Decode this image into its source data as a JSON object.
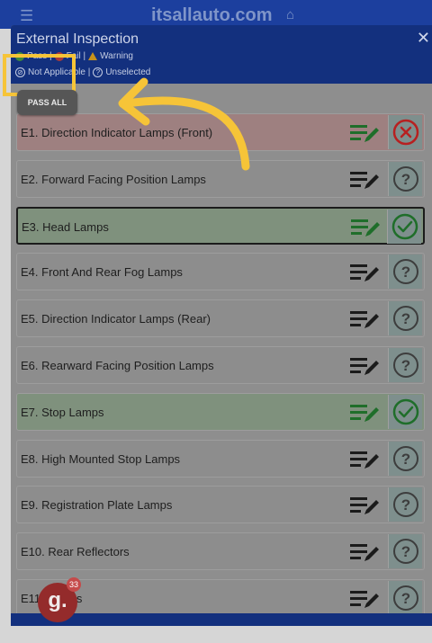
{
  "topbar": {
    "menu_icon": "menu-icon",
    "site_title": "itsallauto.com",
    "home_icon": "home-icon"
  },
  "modal": {
    "title": "External Inspection",
    "close_icon": "close-icon",
    "legend_line1": {
      "pass": "Pass |",
      "fail": "Fail |",
      "warning": "Warning"
    },
    "legend_line2": {
      "not_applicable": "Not Applicable |",
      "unselected": "Unselected"
    },
    "pass_all_label": "PASS ALL"
  },
  "rows": [
    {
      "label": "E1. Direction Indicator Lamps (Front)",
      "status": "fail"
    },
    {
      "label": "E2. Forward Facing Position Lamps",
      "status": "unselected"
    },
    {
      "label": "E3. Head Lamps",
      "status": "pass"
    },
    {
      "label": "E4. Front And Rear Fog Lamps",
      "status": "unselected"
    },
    {
      "label": "E5. Direction Indicator Lamps (Rear)",
      "status": "unselected"
    },
    {
      "label": "E6. Rearward Facing Position Lamps",
      "status": "unselected"
    },
    {
      "label": "E7. Stop Lamps",
      "status": "pass"
    },
    {
      "label": "E8. High Mounted Stop Lamps",
      "status": "unselected"
    },
    {
      "label": "E9. Registration Plate Lamps",
      "status": "unselected"
    },
    {
      "label": "E10. Rear Reflectors",
      "status": "unselected"
    },
    {
      "label": "E11. Lamps",
      "status": "unselected"
    }
  ],
  "badge": {
    "letter": "g.",
    "count": "33"
  },
  "colors": {
    "header_blue": "#13307e",
    "pass_green": "#1f6e2a",
    "fail_red": "#b72020",
    "highlight_yellow": "#f6c438"
  }
}
